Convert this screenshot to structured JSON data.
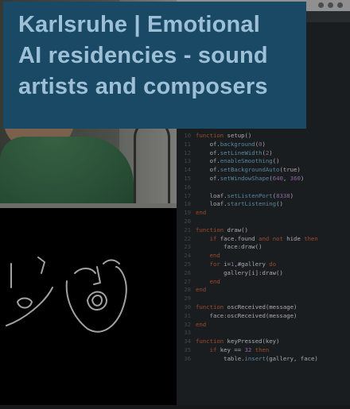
{
  "banner": {
    "title_lines": [
      "Karlsruhe | Emotional",
      "AI residencies - sound",
      "artists and composers"
    ]
  },
  "editor": {
    "code_lines": [
      {
        "n": "10",
        "t": "function setup()"
      },
      {
        "n": "11",
        "t": "    of.background(0)"
      },
      {
        "n": "12",
        "t": "    of.setLineWidth(2)"
      },
      {
        "n": "13",
        "t": "    of.enableSmoothing()"
      },
      {
        "n": "14",
        "t": "    of.setBackgroundAuto(true)"
      },
      {
        "n": "15",
        "t": "    of.setWindowShape(640, 360)"
      },
      {
        "n": "16",
        "t": ""
      },
      {
        "n": "17",
        "t": "    loaf.setListenPort(8338)"
      },
      {
        "n": "18",
        "t": "    loaf.startListening()"
      },
      {
        "n": "19",
        "t": "end"
      },
      {
        "n": "20",
        "t": ""
      },
      {
        "n": "21",
        "t": "function draw()"
      },
      {
        "n": "22",
        "t": "    if face.found and not hide then"
      },
      {
        "n": "23",
        "t": "        face:draw()"
      },
      {
        "n": "24",
        "t": "    end"
      },
      {
        "n": "25",
        "t": "    for i=1,#gallery do"
      },
      {
        "n": "26",
        "t": "        gallery[i]:draw()"
      },
      {
        "n": "27",
        "t": "    end"
      },
      {
        "n": "28",
        "t": "end"
      },
      {
        "n": "29",
        "t": ""
      },
      {
        "n": "30",
        "t": "function oscReceived(message)"
      },
      {
        "n": "31",
        "t": "    face:oscReceived(message)"
      },
      {
        "n": "32",
        "t": "end"
      },
      {
        "n": "33",
        "t": ""
      },
      {
        "n": "34",
        "t": "function keyPressed(key)"
      },
      {
        "n": "35",
        "t": "    if key == 32 then"
      },
      {
        "n": "36",
        "t": "        table.insert(gallery, face)"
      }
    ]
  },
  "colors": {
    "banner_bg": "#1a4966",
    "banner_text": "#9ec0d6",
    "keyword": "#e06a3b",
    "number": "#c790e3"
  }
}
